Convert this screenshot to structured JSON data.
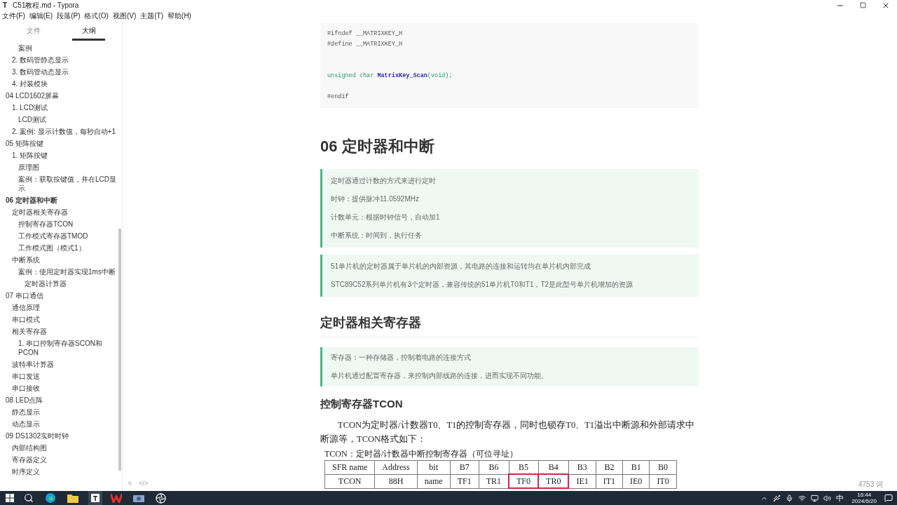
{
  "window": {
    "app_letter": "T",
    "title": "C51教程.md - Typora"
  },
  "menu": [
    "文件(F)",
    "编辑(E)",
    "段落(P)",
    "格式(O)",
    "视图(V)",
    "主题(T)",
    "帮助(H)"
  ],
  "sidebar": {
    "tabs": [
      {
        "label": "文件",
        "selected": false
      },
      {
        "label": "大纲",
        "selected": true
      }
    ],
    "leading_deep": [
      "案例"
    ],
    "leading": [
      "2. 数码管静态显示",
      "3. 数码管动态显示",
      "4. 封装模块"
    ],
    "outline": [
      {
        "label": "04 LCD1602屏幕",
        "active": false,
        "children": [
          {
            "label": "1. LCD测试",
            "children": [
              {
                "label": "LCD测试"
              }
            ]
          },
          {
            "label": "2. 案例: 显示计数值，每秒自动+1"
          }
        ]
      },
      {
        "label": "05 矩阵按键",
        "active": false,
        "children": [
          {
            "label": "1. 矩阵按键",
            "children": [
              {
                "label": "原理图"
              },
              {
                "label": "案例：获取按键值，并在LCD显示"
              }
            ]
          }
        ]
      },
      {
        "label": "06 定时器和中断",
        "active": true,
        "children": [
          {
            "label": "定时器相关寄存器",
            "children": [
              {
                "label": "控制寄存器TCON"
              },
              {
                "label": "工作模式寄存器TMOD"
              },
              {
                "label": "工作模式图（模式1）"
              }
            ]
          },
          {
            "label": "中断系统",
            "children": [
              {
                "label": "案例：使用定时器实现1ms中断",
                "children": [
                  {
                    "label": "定时器计算器"
                  }
                ]
              }
            ]
          }
        ]
      },
      {
        "label": "07 串口通信",
        "active": false,
        "children": [
          {
            "label": "通信原理"
          },
          {
            "label": "串口模式"
          },
          {
            "label": "相关寄存器",
            "children": [
              {
                "label": "1. 串口控制寄存器SCON和PCON"
              }
            ]
          },
          {
            "label": "波特率计算器"
          },
          {
            "label": "串口发送"
          },
          {
            "label": "串口接收"
          }
        ]
      },
      {
        "label": "08 LED点阵",
        "active": false,
        "children": [
          {
            "label": "静态显示"
          },
          {
            "label": "动态显示"
          }
        ]
      },
      {
        "label": "09 DS1302实时时钟",
        "active": false,
        "children": [
          {
            "label": "内部结构图"
          },
          {
            "label": "寄存器定义"
          },
          {
            "label": "时序定义"
          }
        ]
      }
    ],
    "footer": [
      "<",
      "</>"
    ]
  },
  "code": [
    {
      "kind": "line",
      "tokens": [
        {
          "text": "#ifndef __MATRIXKEY_H",
          "kind": "plain"
        }
      ]
    },
    {
      "kind": "line",
      "tokens": [
        {
          "text": "#define __MATRIXKEY_H",
          "kind": "plain"
        }
      ]
    },
    {
      "kind": "blank"
    },
    {
      "kind": "blank"
    },
    {
      "kind": "line",
      "tokens": [
        {
          "text": "unsigned char ",
          "kind": "keyword"
        },
        {
          "text": "MatrixKey_Scan",
          "kind": "function"
        },
        {
          "text": "(void);",
          "kind": "keyword"
        }
      ]
    },
    {
      "kind": "blank"
    },
    {
      "kind": "line",
      "tokens": [
        {
          "text": "#endif",
          "kind": "plain"
        }
      ]
    }
  ],
  "heading": "06 定时器和中断",
  "quotes": [
    [
      "定时器通过计数的方式来进行定时",
      "时钟：提供脉冲11.0592MHz",
      "计数单元：根据时钟信号，自动加1",
      "中断系统：时间到，执行任务"
    ],
    [
      "51单片机的定时器属于单片机的内部资源，其电路的连接和运转均在单片机内部完成",
      "STC89C52系列单片机有3个定时器，兼容传统的51单片机T0和T1，T2是此型号单片机增加的资源"
    ]
  ],
  "section": {
    "heading": "定时器相关寄存器",
    "quote": [
      "寄存器：一种存储器，控制着电路的连接方式",
      "单片机通过配置寄存器，来控制内部线路的连接，进而实现不同功能。"
    ]
  },
  "subsection": {
    "heading": "控制寄存器TCON",
    "paragraph": "TCON为定时器/计数器T0、T1的控制寄存器，同时也锁存T0、T1溢出中断源和外部请求中断源等，TCON格式如下：",
    "caption": "TCON：定时器/计数器中断控制寄存器（可位寻址）",
    "table": [
      [
        {
          "text": "SFR name",
          "highlighted": false
        },
        {
          "text": "Address",
          "highlighted": false
        },
        {
          "text": "bit",
          "highlighted": false
        },
        {
          "text": "B7",
          "highlighted": false
        },
        {
          "text": "B6",
          "highlighted": false
        },
        {
          "text": "B5",
          "highlighted": false
        },
        {
          "text": "B4",
          "highlighted": false
        },
        {
          "text": "B3",
          "highlighted": false
        },
        {
          "text": "B2",
          "highlighted": false
        },
        {
          "text": "B1",
          "highlighted": false
        },
        {
          "text": "B0",
          "highlighted": false
        }
      ],
      [
        {
          "text": "TCON",
          "highlighted": false
        },
        {
          "text": "88H",
          "highlighted": false
        },
        {
          "text": "name",
          "highlighted": false
        },
        {
          "text": "TF1",
          "highlighted": false
        },
        {
          "text": "TR1",
          "highlighted": false
        },
        {
          "text": "TF0",
          "highlighted": true
        },
        {
          "text": "TR0",
          "highlighted": true
        },
        {
          "text": "IE1",
          "highlighted": false
        },
        {
          "text": "IT1",
          "highlighted": false
        },
        {
          "text": "IE0",
          "highlighted": false
        },
        {
          "text": "IT0",
          "highlighted": false
        }
      ]
    ]
  },
  "status_bar": {
    "word_count": "4753 词"
  },
  "taskbar": {
    "ime": "中",
    "time": "16:44",
    "date": "2024/5/20"
  }
}
